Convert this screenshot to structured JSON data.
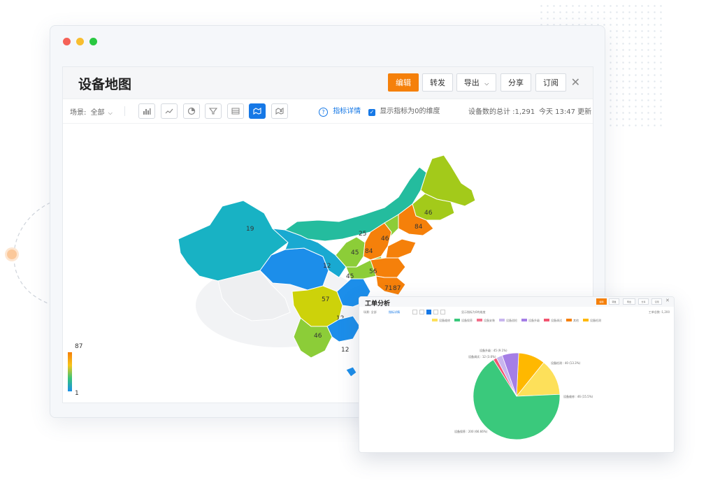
{
  "panel": {
    "title": "设备地图",
    "buttons": {
      "edit": "编辑",
      "forward": "转发",
      "export": "导出",
      "share": "分享",
      "subscribe": "订阅"
    },
    "close_glyph": "✕"
  },
  "toolbar": {
    "scene_label": "场景:",
    "scene_value": "全部",
    "chart_types": [
      "bar-chart-icon",
      "line-chart-icon",
      "pie-chart-icon",
      "funnel-chart-icon",
      "table-icon",
      "map-icon",
      "map-bubble-icon"
    ],
    "active_chart_type": "map-icon",
    "metric_details": "指标详情",
    "show_zero_label": "显示指标为0的维度",
    "show_zero_checked": true,
    "total_text": "设备数的总计 :1,291",
    "updated_text": "今天 13:47 更新"
  },
  "map": {
    "legend_max": "87",
    "legend_min": "1",
    "region_values": [
      "19",
      "25",
      "51",
      "46",
      "84",
      "45",
      "84",
      "46",
      "80",
      "12",
      "45",
      "56",
      "57",
      "71",
      "87",
      "12",
      "46",
      "12"
    ]
  },
  "work_order_card": {
    "title": "工单分析",
    "buttons": [
      "编辑",
      "转发",
      "导出",
      "分享",
      "订阅"
    ],
    "scene_label": "场景: 全部",
    "metric_link": "指标详情",
    "show_zero_label": "显示指标为0的维度",
    "total_text": "工单总数 :1,200",
    "legend": [
      {
        "name": "设备维修",
        "color": "#fde05a"
      },
      {
        "name": "设备保养",
        "color": "#3ac97c"
      },
      {
        "name": "设备安装",
        "color": "#f36f8a"
      },
      {
        "name": "设备巡检",
        "color": "#c8b5ee"
      },
      {
        "name": "设备升级",
        "color": "#a57ee6"
      },
      {
        "name": "设备调试",
        "color": "#f25570"
      },
      {
        "name": "其他",
        "color": "#f5800a"
      },
      {
        "name": "设备检测",
        "color": "#ffb800"
      }
    ],
    "pie_labels": [
      {
        "text": "设备保养 : 200 (66.66%)"
      },
      {
        "text": "设备维修 : 46 (15.5%)"
      },
      {
        "text": "设备检测 : 40 (13.3%)"
      },
      {
        "text": "设备升级 : 45 (9.1%)"
      },
      {
        "text": "设备调试 : 12 (3.6%)"
      }
    ]
  },
  "chart_data": {
    "type": "pie",
    "title": "",
    "categories": [
      "设备保养",
      "设备维修",
      "设备检测",
      "设备升级",
      "设备巡检",
      "设备调试"
    ],
    "values": [
      66.7,
      13.5,
      10.0,
      6.2,
      2.3,
      1.3
    ],
    "colors": [
      "#3ac97c",
      "#fde05a",
      "#ffb800",
      "#a57ee6",
      "#c8b5ee",
      "#f25570"
    ]
  }
}
